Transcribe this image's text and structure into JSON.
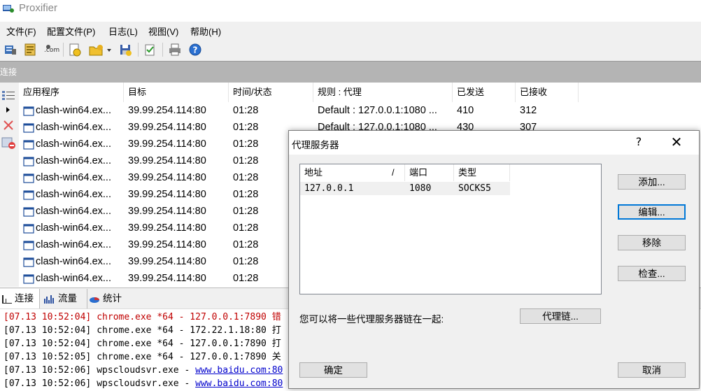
{
  "window": {
    "title": "Proxifier"
  },
  "menu": [
    "文件(F)",
    "配置文件(P)",
    "日志(L)",
    "视图(V)",
    "帮助(H)"
  ],
  "toolbar_icons": [
    "server-icon",
    "profile-icon",
    "dotcom-icon",
    "open-icon",
    "folder-icon",
    "save-icon",
    "check-icon",
    "print-icon",
    "help-icon"
  ],
  "section": {
    "connections_label": "连接"
  },
  "table": {
    "columns": [
      "应用程序",
      "目标",
      "时间/状态",
      "规则 : 代理",
      "已发送",
      "已接收"
    ],
    "rows": [
      {
        "app": "clash-win64.ex...",
        "target": "39.99.254.114:80",
        "time": "01:28",
        "rule": "Default : 127.0.0.1:1080 ...",
        "sent": "410",
        "recv": "312"
      },
      {
        "app": "clash-win64.ex...",
        "target": "39.99.254.114:80",
        "time": "01:28",
        "rule": "Default : 127.0.0.1:1080 ...",
        "sent": "430",
        "recv": "307"
      },
      {
        "app": "clash-win64.ex...",
        "target": "39.99.254.114:80",
        "time": "01:28",
        "rule": "",
        "sent": "",
        "recv": ""
      },
      {
        "app": "clash-win64.ex...",
        "target": "39.99.254.114:80",
        "time": "01:28",
        "rule": "",
        "sent": "",
        "recv": ""
      },
      {
        "app": "clash-win64.ex...",
        "target": "39.99.254.114:80",
        "time": "01:28",
        "rule": "",
        "sent": "",
        "recv": ""
      },
      {
        "app": "clash-win64.ex...",
        "target": "39.99.254.114:80",
        "time": "01:28",
        "rule": "",
        "sent": "",
        "recv": ""
      },
      {
        "app": "clash-win64.ex...",
        "target": "39.99.254.114:80",
        "time": "01:28",
        "rule": "",
        "sent": "",
        "recv": ""
      },
      {
        "app": "clash-win64.ex...",
        "target": "39.99.254.114:80",
        "time": "01:28",
        "rule": "",
        "sent": "",
        "recv": ""
      },
      {
        "app": "clash-win64.ex...",
        "target": "39.99.254.114:80",
        "time": "01:28",
        "rule": "",
        "sent": "",
        "recv": ""
      },
      {
        "app": "clash-win64.ex...",
        "target": "39.99.254.114:80",
        "time": "01:28",
        "rule": "",
        "sent": "",
        "recv": ""
      },
      {
        "app": "clash-win64.ex...",
        "target": "39.99.254.114:80",
        "time": "01:28",
        "rule": "",
        "sent": "",
        "recv": ""
      }
    ]
  },
  "tabs": [
    "连接",
    "流量",
    "统计"
  ],
  "log": [
    {
      "time": "[07.13 10:52:04]",
      "text": "chrome.exe *64 - 127.0.0.1:7890 错",
      "color": "#c00000",
      "link": ""
    },
    {
      "time": "[07.13 10:52:04]",
      "text": "chrome.exe *64 - 172.22.1.18:80 打",
      "color": "#000000",
      "link": ""
    },
    {
      "time": "[07.13 10:52:04]",
      "text": "chrome.exe *64 - 127.0.0.1:7890 打",
      "color": "#000000",
      "link": ""
    },
    {
      "time": "[07.13 10:52:05]",
      "text": "chrome.exe *64 - 127.0.0.1:7890 关",
      "color": "#000000",
      "link": ""
    },
    {
      "time": "[07.13 10:52:06]",
      "text": "wpscloudsvr.exe - ",
      "color": "#000000",
      "link": "www.baidu.com:80"
    },
    {
      "time": "[07.13 10:52:06]",
      "text": "wpscloudsvr.exe - ",
      "color": "#000000",
      "link": "www.baidu.com:80"
    }
  ],
  "dialog": {
    "title": "代理服务器",
    "help": "?",
    "close": "✕",
    "list_columns": [
      "地址",
      "/",
      "端口",
      "类型"
    ],
    "list_rows": [
      {
        "address": "127.0.0.1",
        "port": "1080",
        "type": "SOCKS5"
      }
    ],
    "buttons": {
      "add": "添加...",
      "edit": "编辑...",
      "remove": "移除",
      "check": "检查...",
      "chain": "代理链...",
      "ok": "确定",
      "cancel": "取消"
    },
    "chain_text": "您可以将一些代理服务器链在一起:"
  },
  "colors": {
    "accent": "#0078d7",
    "error": "#c00000",
    "link": "#0000cc"
  }
}
